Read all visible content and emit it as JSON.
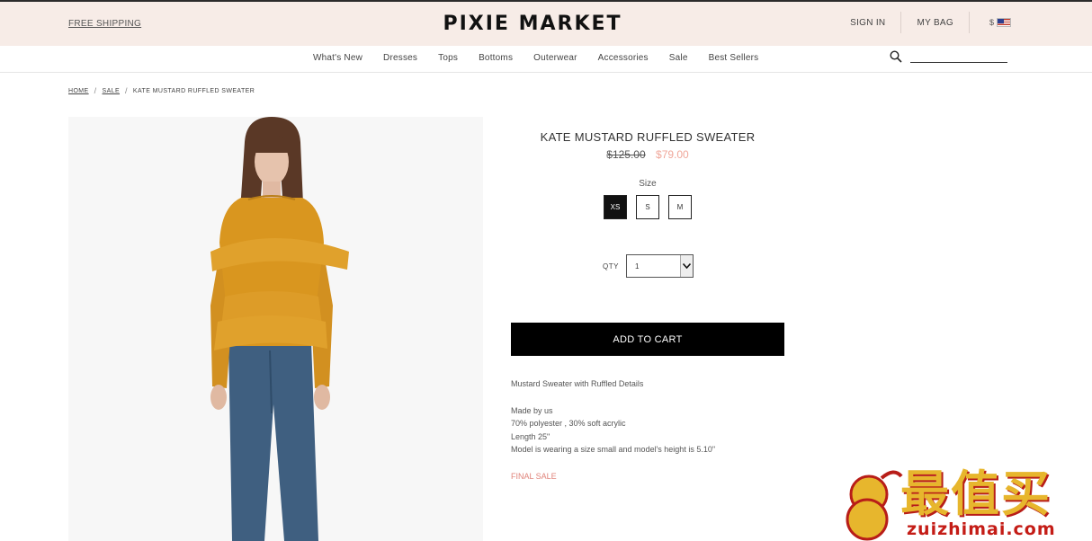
{
  "header": {
    "free_shipping": "FREE SHIPPING",
    "logo": "PIXIE MARKET",
    "sign_in": "SIGN IN",
    "my_bag": "MY BAG",
    "currency": "$"
  },
  "nav": {
    "items": [
      "What's New",
      "Dresses",
      "Tops",
      "Bottoms",
      "Outerwear",
      "Accessories",
      "Sale",
      "Best Sellers"
    ],
    "search_placeholder": ""
  },
  "breadcrumb": {
    "home": "HOME",
    "sale": "SALE",
    "current": "KATE MUSTARD RUFFLED SWEATER"
  },
  "product": {
    "title": "KATE MUSTARD RUFFLED SWEATER",
    "old_price": "$125.00",
    "new_price": "$79.00",
    "size_label": "Size",
    "sizes": [
      "XS",
      "S",
      "M"
    ],
    "selected_size": "XS",
    "qty_label": "QTY",
    "qty_value": "1",
    "add_to_cart": "ADD TO CART",
    "short_description": "Mustard Sweater with Ruffled Details",
    "details": [
      "Made by us",
      "70% polyester , 30% soft acrylic",
      "Length 25\"",
      "Model is wearing a size small and model's height is 5.10\""
    ],
    "final_sale": "FINAL SALE"
  },
  "watermark": {
    "text": "最值买",
    "url": "zuizhimai.com"
  },
  "colors": {
    "topbar_bg": "#f7ece7",
    "sale_price": "#f0a79a",
    "final_sale": "#e0837a",
    "sweater": "#d9961f",
    "jeans": "#3f5f80"
  }
}
